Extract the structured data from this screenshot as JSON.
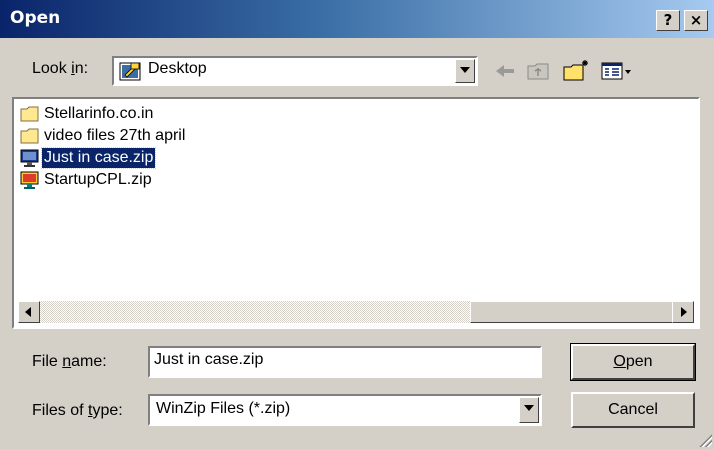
{
  "window": {
    "title": "Open",
    "help_glyph": "?",
    "close_glyph": "×"
  },
  "lookin": {
    "label_pre": "Look ",
    "label_accel": "i",
    "label_post": "n:",
    "value": "Desktop",
    "icon": "desktop-icon"
  },
  "toolbar": {
    "icons": [
      "back-arrow-icon",
      "up-folder-icon",
      "new-folder-icon",
      "view-menu-icon"
    ]
  },
  "files": [
    {
      "name": "Stellarinfo.co.in",
      "icon": "folder-icon",
      "selected": false
    },
    {
      "name": "video files 27th april",
      "icon": "folder-icon",
      "selected": false
    },
    {
      "name": "Just in case.zip",
      "icon": "winzip-icon",
      "selected": true
    },
    {
      "name": "StartupCPL.zip",
      "icon": "winzip-icon",
      "selected": false
    }
  ],
  "filename": {
    "label_pre": "File ",
    "label_accel": "n",
    "label_post": "ame:",
    "value": "Just in case.zip"
  },
  "filetype": {
    "label_pre": "Files of ",
    "label_accel": "t",
    "label_post": "ype:",
    "value": "WinZip Files (*.zip)"
  },
  "buttons": {
    "open_accel": "O",
    "open_rest": "pen",
    "cancel": "Cancel"
  },
  "colors": {
    "selection": "#0a246a",
    "face": "#d4d0c8"
  }
}
